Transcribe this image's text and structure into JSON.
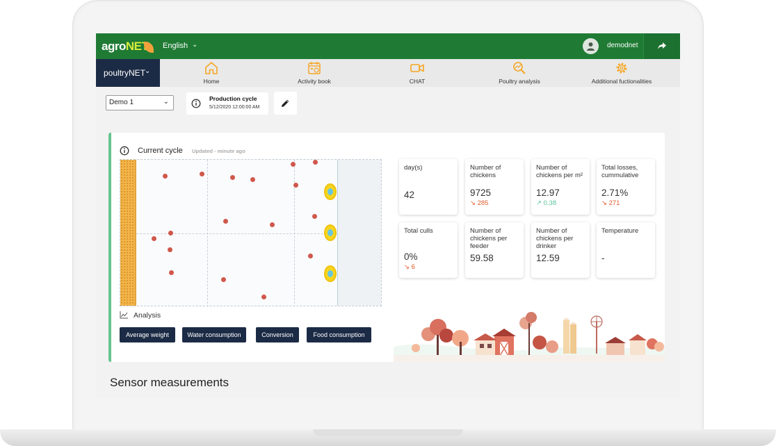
{
  "header": {
    "logo_main": "agro",
    "logo_accent": "NET",
    "language": "English",
    "username": "demodnet"
  },
  "nav": {
    "module": "poultryNET",
    "items": [
      {
        "label": "Home",
        "icon": "home-icon"
      },
      {
        "label": "Activity book",
        "icon": "calendar-icon"
      },
      {
        "label": "CHAT",
        "icon": "video-icon"
      },
      {
        "label": "Poultry analysis",
        "icon": "magnifier-chart-icon"
      },
      {
        "label": "Additional fuctionalities",
        "icon": "gear-icon"
      }
    ]
  },
  "toolbar": {
    "farm_selected": "Demo 1",
    "production_cycle_title": "Production cycle",
    "production_cycle_date": "5/12/2020 12:00:00 AM"
  },
  "current_cycle": {
    "title": "Current cycle",
    "updated": "Updated - minute ago",
    "analysis_label": "Analysis",
    "buttons": [
      "Average weight",
      "Water consumption",
      "Conversion",
      "Food consumption"
    ]
  },
  "stats": [
    {
      "label": "day(s)",
      "value": "42",
      "delta": "",
      "trend": ""
    },
    {
      "label": "Number of chickens",
      "value": "9725",
      "delta": "285",
      "trend": "down"
    },
    {
      "label": "Number of chickens per m²",
      "value": "12.97",
      "delta": "0.38",
      "trend": "up"
    },
    {
      "label": "Total losses, cummulative",
      "value": "2.71%",
      "delta": "271",
      "trend": "down"
    },
    {
      "label": "Total culls",
      "value": "0%",
      "delta": "6",
      "trend": "down"
    },
    {
      "label": "Number of chickens per feeder",
      "value": "59.58",
      "delta": "",
      "trend": ""
    },
    {
      "label": "Number of chickens per drinker",
      "value": "12.59",
      "delta": "",
      "trend": ""
    },
    {
      "label": "Temperature",
      "value": "-",
      "delta": "",
      "trend": ""
    }
  ],
  "sensor_section": {
    "title": "Sensor measurements"
  },
  "colors": {
    "header_green": "#1f7b34",
    "nav_dark": "#1c2b45",
    "accent_orange": "#f5a623",
    "delta_down": "#e05a2c",
    "delta_up": "#59c49a",
    "sensor_dot": "#d0574b"
  }
}
